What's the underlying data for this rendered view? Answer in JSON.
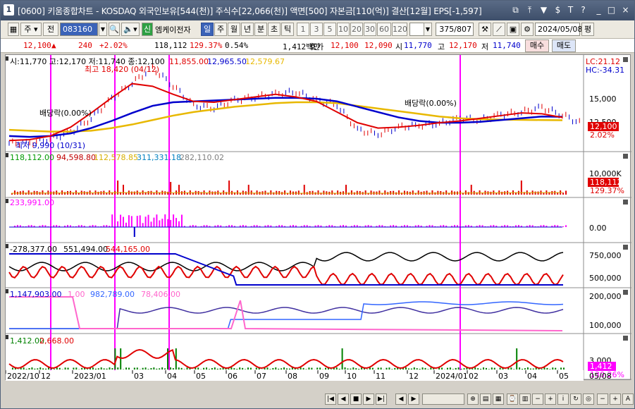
{
  "window": {
    "index": "1",
    "title": "[0600] 키움종합차트 - KOSDAQ 외국인보유[544(천)] 주식수[22,066(천)] 액면[500] 자본금[110(억)] 결산[12월] EPS[-1,597]",
    "title_buttons": [
      "⧉",
      "⤒",
      "▼",
      "$",
      "T",
      "?",
      "_",
      "□",
      "×"
    ]
  },
  "toolbar": {
    "type_label": "주",
    "market_label": "전",
    "stock_code": "083160",
    "stock_badge": "신",
    "stock_name": "엠케이전자",
    "period_buttons": [
      "일",
      "주",
      "월",
      "년",
      "분",
      "초",
      "틱"
    ],
    "selected_period": "일",
    "tick_numbers": [
      "1",
      "3",
      "5",
      "10",
      "20",
      "30",
      "60",
      "120"
    ],
    "count_value": "375",
    "count_total": "/807",
    "date_value": "2024/05/08",
    "pyeong_label": "평"
  },
  "quote": {
    "price": "12,100",
    "change_arrow": "▲",
    "change": "240",
    "change_pct": "+2.02%",
    "volume": "118,112",
    "volume_ratio": "129.37%",
    "turnover": "0.54%",
    "amount": "1,412백만",
    "hoga_label": "호가",
    "bid": "12,100",
    "ask": "12,090",
    "open_label": "시",
    "open": "11,770",
    "high_label": "고",
    "high": "12,170",
    "low_label": "저",
    "low": "11,740",
    "buy_label": "매수",
    "sell_label": "매도"
  },
  "chart": {
    "panel1": {
      "header": "시:11,770 고:12,170 저:11,740 종:12,100",
      "ma_values": [
        "11,855.00",
        "12,965.50",
        "12,579.67"
      ],
      "ma_colors": [
        "#e00000",
        "#0000cc",
        "#e8b800"
      ],
      "right_top1": "LC:21.12",
      "right_top2": "HC:-34.31",
      "y_labels": [
        "15,000",
        "12,500",
        "10,000"
      ],
      "price_tag": "12,100",
      "pct_tag": "2.02%",
      "annotation_high": "최고 18,420 (04/12)",
      "annotation_low": "최저 9,990 (10/31)",
      "dividend1": "배당락(0.00%)",
      "dividend2": "배당락(0.00%)"
    },
    "panel2": {
      "header": [
        "118,112.00",
        "94,598.80",
        "112,578.85",
        "311,331.18",
        "282,110.02"
      ],
      "colors": [
        "#009900",
        "#c00000",
        "#d8b000",
        "#0080c0",
        "#808080"
      ],
      "y_labels": [
        "10,000K"
      ],
      "vol_tag": "118,112",
      "vol_pct_tag": "129.37%"
    },
    "panel3": {
      "header": "233,991.00",
      "y_labels": [
        "0.00"
      ]
    },
    "panel4": {
      "header": [
        "-278,377.00",
        "551,494.00",
        "544,165.00"
      ],
      "colors": [
        "#000000",
        "#000000",
        "#e00000"
      ],
      "y_labels": [
        "750,000",
        "500,000"
      ]
    },
    "panel5": {
      "header": [
        "1,147,903.00",
        "1.00",
        "982,789.00",
        "78,406.00"
      ],
      "colors": [
        "#0000cc",
        "#ff66cc",
        "#3366ff",
        "#ff66cc"
      ],
      "y_labels": [
        "200,000",
        "100,000"
      ]
    },
    "panel6": {
      "header": [
        "1,412.00",
        "2,668.00"
      ],
      "colors": [
        "#008000",
        "#e00000"
      ],
      "y_labels": [
        "3,000"
      ],
      "amt_tag": "1,412",
      "amt_pct_tag": "130.26%"
    },
    "x_labels": [
      "2022/10",
      "12",
      "2023/01",
      "03",
      "04",
      "05",
      "06",
      "07",
      "08",
      "09",
      "10",
      "11",
      "12",
      "2024/01",
      "02",
      "03",
      "04",
      "05"
    ],
    "x_last_label": "05/08"
  },
  "chart_data": {
    "type": "line",
    "title": "엠케이전자 일봉",
    "series": [
      {
        "name": "종가",
        "values": [
          9990,
          10500,
          11200,
          12800,
          15000,
          16800,
          18420,
          16500,
          14200,
          14000,
          14800,
          15200,
          15500,
          15800,
          14800,
          14300,
          11500,
          11000,
          11800,
          12000,
          12200,
          12800,
          12600,
          13200,
          13500,
          14000,
          13200,
          12100
        ]
      },
      {
        "name": "MA20",
        "values": [
          10300,
          10400,
          10800,
          11800,
          13400,
          15100,
          16700,
          16400,
          15500,
          14700,
          14600,
          14900,
          15200,
          15500,
          15200,
          14700,
          13500,
          12300,
          11700,
          11800,
          12000,
          12300,
          12500,
          12800,
          13100,
          13400,
          13300,
          12900
        ]
      },
      {
        "name": "MA60",
        "values": [
          10800,
          10700,
          10800,
          11100,
          11700,
          12500,
          13400,
          14200,
          14600,
          14700,
          14800,
          14900,
          15000,
          15100,
          15100,
          15000,
          14700,
          14100,
          13500,
          12900,
          12500,
          12300,
          12300,
          12400,
          12600,
          12800,
          13000,
          12965
        ]
      },
      {
        "name": "MA120",
        "values": [
          11500,
          11400,
          11300,
          11300,
          11400,
          11700,
          12100,
          12600,
          13100,
          13500,
          13800,
          14100,
          14300,
          14500,
          14600,
          14600,
          14500,
          14200,
          13900,
          13600,
          13300,
          13000,
          12800,
          12700,
          12650,
          12620,
          12600,
          12580
        ]
      }
    ]
  }
}
